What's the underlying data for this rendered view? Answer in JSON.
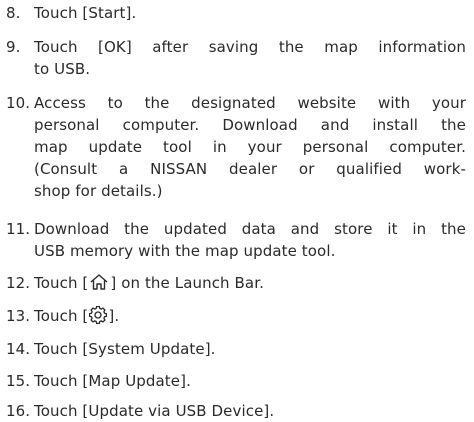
{
  "steps": [
    {
      "number": "8.",
      "lines": [
        "Touch [Start]."
      ]
    },
    {
      "number": "9.",
      "lines": [
        "Touch [OK] after saving the map information",
        "to USB."
      ]
    },
    {
      "number": "10.",
      "lines": [
        "Access to the designated website with your",
        "personal computer. Download and install the",
        "map update tool in your personal computer.",
        "(Consult a NISSAN dealer or qualified work-",
        "shop for details.)"
      ]
    },
    {
      "number": "11.",
      "lines": [
        "Download the updated data and store it in the",
        "USB memory with the map update tool."
      ]
    },
    {
      "number": "12.",
      "before": "Touch [",
      "icon": "home-icon",
      "after": "] on the Launch Bar."
    },
    {
      "number": "13.",
      "before": "Touch [",
      "icon": "gear-icon",
      "after": "]."
    },
    {
      "number": "14.",
      "lines": [
        "Touch [System Update]."
      ]
    },
    {
      "number": "15.",
      "lines": [
        "Touch [Map Update]."
      ]
    },
    {
      "number": "16.",
      "lines": [
        "Touch [Update via USB Device]."
      ]
    }
  ]
}
